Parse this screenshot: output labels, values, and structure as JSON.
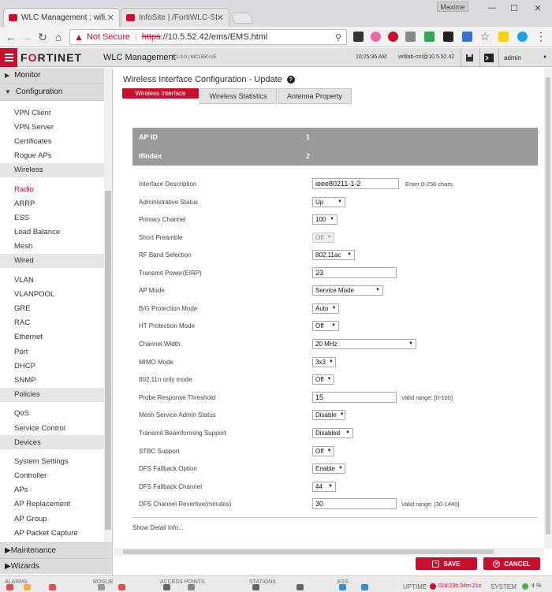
{
  "browser": {
    "tabs": [
      {
        "label": "WLC Management : wifi..."
      },
      {
        "label": "InfoSite | /FortiWLC-SD/..."
      }
    ],
    "user": "Maxime",
    "address": {
      "security": "Not Secure",
      "scheme": "https",
      "url_rest": "://10.5.52.42/ems/EMS.html"
    }
  },
  "app": {
    "brand": "FORTINET",
    "title": "WLC Management",
    "version": "8.2-3-0 | MC1550-VE",
    "time": "10:25:36 AM",
    "controller": "wifilab-ctrl@10.5.52.42",
    "user": "admin"
  },
  "sidebar": {
    "monitor": "Monitor",
    "configuration": "Configuration",
    "items_top": [
      "VPN Client",
      "VPN Server",
      "Certificates",
      "Rogue APs"
    ],
    "wireless": "Wireless",
    "wireless_items": [
      "Radio",
      "ARRP",
      "ESS",
      "Load Balance",
      "Mesh"
    ],
    "wired": "Wired",
    "wired_items": [
      "VLAN",
      "VLANPOOL",
      "GRE",
      "RAC",
      "Ethernet",
      "Port",
      "DHCP",
      "SNMP"
    ],
    "policies": "Policies",
    "policies_items": [
      "QoS",
      "Service Control"
    ],
    "devices": "Devices",
    "devices_items": [
      "System Settings",
      "Controller",
      "APs",
      "AP Replacement",
      "AP Group",
      "AP Packet Capture"
    ],
    "maintenance": "Maintenance",
    "wizards": "Wizards"
  },
  "page": {
    "title": "Wireless Interface Configuration - Update",
    "tabs": [
      "Wireless Interface",
      "Wireless Statistics",
      "Antenna Property"
    ],
    "ap_id_label": "AP ID",
    "ap_id": "1",
    "ifindex_label": "IfIndex",
    "ifindex": "2",
    "fields": {
      "interface_description": {
        "label": "Interface Description",
        "value": "ieee80211-1-2",
        "hint": "Enter 0-256 chars."
      },
      "admin_status": {
        "label": "Administrative Status",
        "value": "Up"
      },
      "primary_channel": {
        "label": "Primary Channel",
        "value": "100"
      },
      "short_preamble": {
        "label": "Short Preamble",
        "value": "Off"
      },
      "rf_band": {
        "label": "RF Band Selection",
        "value": "802.11ac"
      },
      "tx_power": {
        "label": "Transmit Power(EIRP)",
        "value": "23"
      },
      "ap_mode": {
        "label": "AP Mode",
        "value": "Service Mode"
      },
      "bg_protection": {
        "label": "B/G Protection Mode",
        "value": "Auto"
      },
      "ht_protection": {
        "label": "HT Protection Mode",
        "value": "Off"
      },
      "channel_width": {
        "label": "Channel Width",
        "value": "20 MHz"
      },
      "mimo_mode": {
        "label": "MIMO Mode",
        "value": "3x3"
      },
      "n_only": {
        "label": "802.11n only mode",
        "value": "Off"
      },
      "probe_threshold": {
        "label": "Probe Response Threshold",
        "value": "15",
        "hint": "Valid range: [0-100]"
      },
      "mesh_admin": {
        "label": "Mesh Service Admin Status",
        "value": "Disable"
      },
      "beamforming": {
        "label": "Transmit Beamforming Support",
        "value": "Disabled"
      },
      "stbc": {
        "label": "STBC Support",
        "value": "Off"
      },
      "dfs_fallback_option": {
        "label": "DFS Fallback Option",
        "value": "Enable"
      },
      "dfs_fallback_channel": {
        "label": "DFS Fallback Channel",
        "value": "44"
      },
      "dfs_revertive": {
        "label": "DFS Channel Revertive(minutes)",
        "value": "30",
        "hint": "Valid range: [30-1440]"
      }
    },
    "show_detail": "Show Detail Info...",
    "save": "SAVE",
    "cancel": "CANCEL"
  },
  "statusbar": {
    "alarms": "ALARMS",
    "rogue": "ROGUE",
    "access_points": "ACCESS POINTS",
    "stations": "STATIONS",
    "ess": "ESS",
    "uptime_label": "UPTIME",
    "uptime": "02d:23h:34m:21s",
    "system_label": "SYSTEM",
    "system_value": "4 %"
  }
}
